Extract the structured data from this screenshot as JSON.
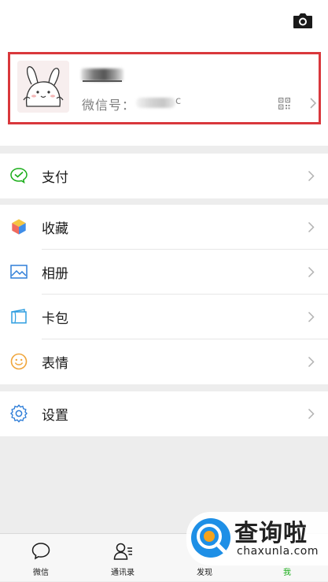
{
  "profile": {
    "wechat_id_label": "微信号：",
    "wechat_id_tail": "c"
  },
  "menu": {
    "pay": "支付",
    "favorites": "收藏",
    "album": "相册",
    "cards": "卡包",
    "stickers": "表情",
    "settings": "设置"
  },
  "tabbar": {
    "chats": "微信",
    "contacts": "通讯录",
    "discover": "发现",
    "me": "我"
  },
  "watermark": {
    "title": "查询啦",
    "url": "chaxunla.com"
  },
  "colors": {
    "accent": "#1aad19",
    "highlight_border": "#d9383c",
    "background": "#ededed"
  },
  "icons": [
    "camera-icon",
    "qr-code-icon",
    "pay-icon",
    "favorites-icon",
    "album-icon",
    "cards-icon",
    "stickers-icon",
    "settings-icon",
    "chats-icon",
    "contacts-icon",
    "discover-icon",
    "me-icon"
  ]
}
